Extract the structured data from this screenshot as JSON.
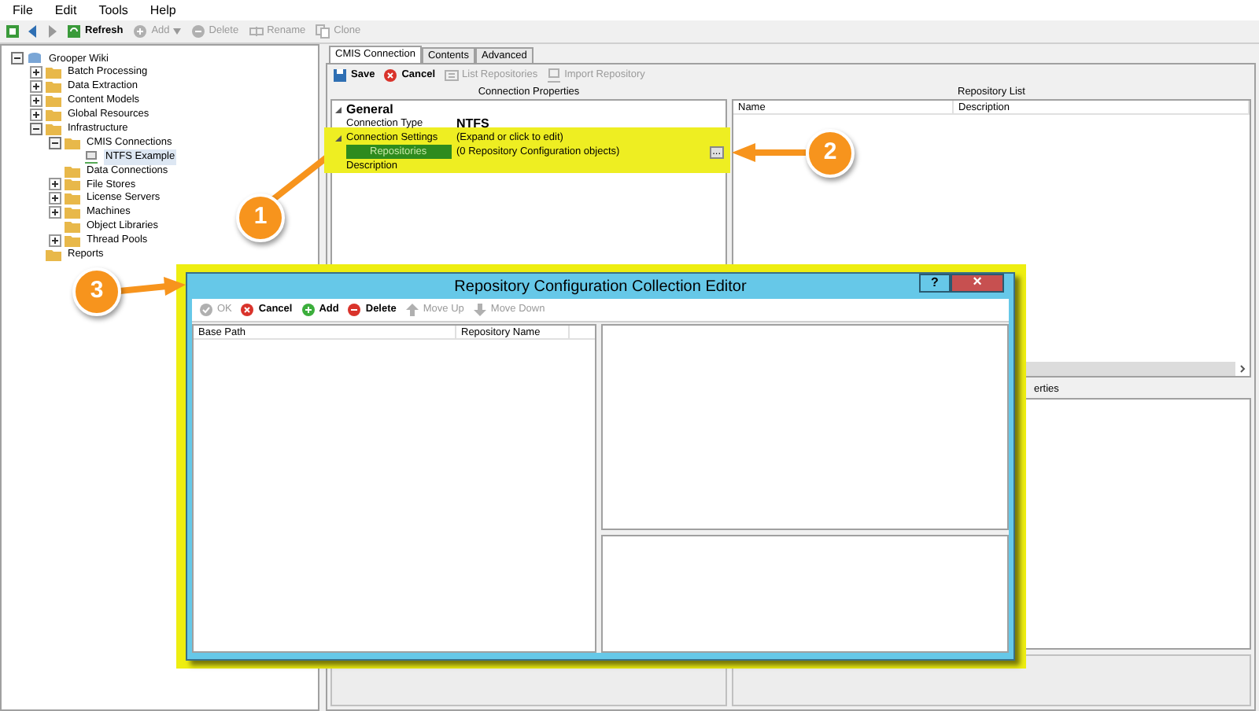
{
  "menu": [
    {
      "label": "File"
    },
    {
      "label": "Edit"
    },
    {
      "label": "Tools"
    },
    {
      "label": "Help"
    }
  ],
  "toolbar": [
    {
      "kind": "refresh",
      "label": "Refresh",
      "disabled": false
    },
    {
      "kind": "add",
      "label": "Add",
      "disabled": true,
      "dropdown": true
    },
    {
      "kind": "delete",
      "label": "Delete",
      "disabled": true
    },
    {
      "kind": "rename",
      "label": "Rename",
      "disabled": true
    },
    {
      "kind": "clone",
      "label": "Clone",
      "disabled": true
    }
  ],
  "tree": [
    {
      "label": "Grooper Wiki",
      "kind": "root",
      "expanded": true,
      "selected": false,
      "children": [
        {
          "label": "Batch Processing",
          "kind": "folder",
          "expanded": false,
          "selected": false
        },
        {
          "label": "Data Extraction",
          "kind": "folder",
          "expanded": false,
          "selected": false
        },
        {
          "label": "Content Models",
          "kind": "folder",
          "expanded": false,
          "selected": false
        },
        {
          "label": "Global Resources",
          "kind": "folder",
          "expanded": false,
          "selected": false
        },
        {
          "label": "Infrastructure",
          "kind": "folder",
          "expanded": true,
          "selected": false,
          "children": [
            {
              "label": "CMIS Connections",
              "kind": "folder",
              "expanded": true,
              "selected": false,
              "children": [
                {
                  "label": "NTFS Example",
                  "kind": "connection",
                  "selected": true
                }
              ]
            },
            {
              "label": "Data Connections",
              "kind": "folder",
              "selected": false
            },
            {
              "label": "File Stores",
              "kind": "folder",
              "expanded": false,
              "selected": false
            },
            {
              "label": "License Servers",
              "kind": "folder",
              "expanded": false,
              "selected": false
            },
            {
              "label": "Machines",
              "kind": "folder",
              "expanded": false,
              "selected": false
            },
            {
              "label": "Object Libraries",
              "kind": "folder",
              "selected": false
            },
            {
              "label": "Thread Pools",
              "kind": "folder",
              "expanded": false,
              "selected": false
            }
          ]
        },
        {
          "label": "Reports",
          "kind": "folder",
          "selected": false
        }
      ]
    }
  ],
  "tabs": [
    {
      "label": "CMIS Connection",
      "selected": true
    },
    {
      "label": "Contents",
      "selected": false
    },
    {
      "label": "Advanced",
      "selected": false
    }
  ],
  "editor_toolbar": [
    {
      "kind": "save",
      "label": "Save",
      "disabled": false
    },
    {
      "kind": "cancel",
      "label": "Cancel",
      "disabled": false
    },
    {
      "kind": "list",
      "label": "List Repositories",
      "disabled": true
    },
    {
      "kind": "import",
      "label": "Import Repository",
      "disabled": true
    }
  ],
  "connection_properties": {
    "title": "Connection Properties",
    "rows": [
      {
        "kind": "category",
        "name": "General",
        "expanded": true
      },
      {
        "kind": "property",
        "name": "Connection Type",
        "value": "NTFS",
        "value_bold": true
      },
      {
        "kind": "category_property",
        "name": "Connection Settings",
        "value": "(Expand or click to edit)",
        "expanded": true
      },
      {
        "kind": "child",
        "name": "Repositories",
        "value": "(0 Repository Configuration objects)",
        "selected": true,
        "ellipsis": "..."
      },
      {
        "kind": "property",
        "name": "Description"
      }
    ]
  },
  "repository_list": {
    "title": "Repository List",
    "columns": [
      "Name",
      "Description"
    ]
  },
  "lower_panel": {
    "title_visible_part": "erties"
  },
  "dialog": {
    "title": "Repository Configuration Collection Editor",
    "help": "?",
    "close": "×",
    "toolbar": [
      {
        "kind": "ok",
        "label": "OK",
        "disabled": true
      },
      {
        "kind": "cancel",
        "label": "Cancel",
        "disabled": false
      },
      {
        "kind": "add",
        "label": "Add",
        "disabled": false
      },
      {
        "kind": "delete",
        "label": "Delete",
        "disabled": false
      },
      {
        "kind": "up",
        "label": "Move Up",
        "disabled": true
      },
      {
        "kind": "down",
        "label": "Move Down",
        "disabled": true
      }
    ],
    "columns": [
      "Base Path",
      "Repository Name"
    ]
  },
  "callouts": [
    "1",
    "2",
    "3"
  ]
}
